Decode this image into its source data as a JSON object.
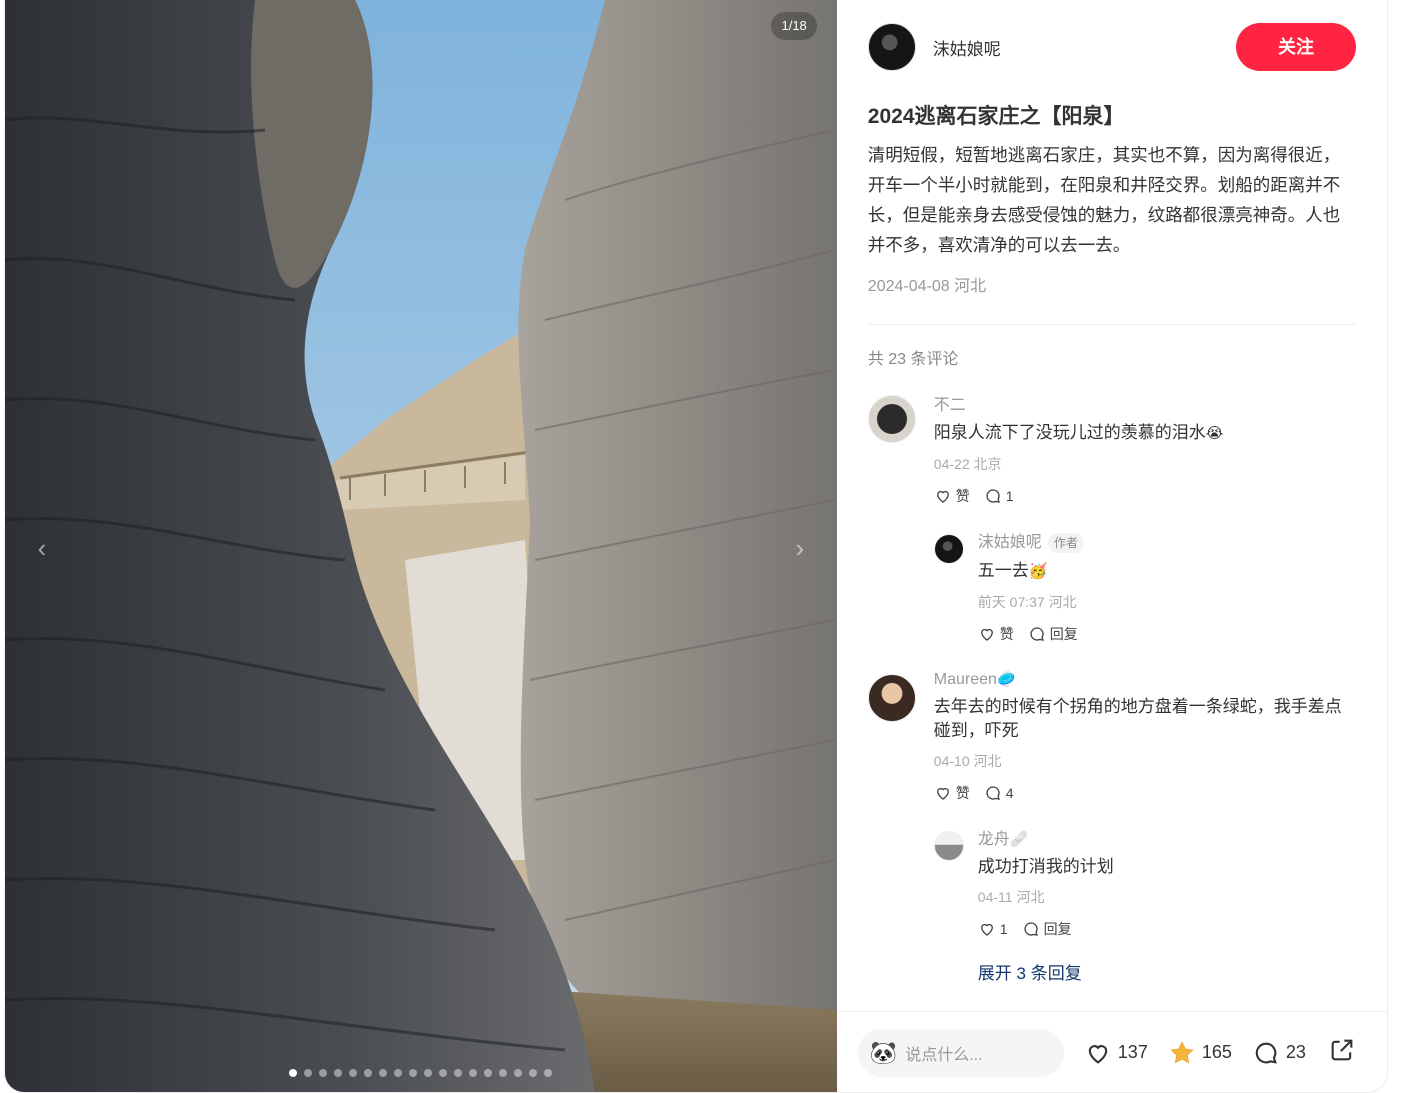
{
  "image": {
    "counter": "1/18",
    "dot_count": 18,
    "active_dot": 0,
    "prev_icon": "chevron-left-icon",
    "next_icon": "chevron-right-icon"
  },
  "author": {
    "name": "沫姑娘呢",
    "follow_label": "关注"
  },
  "post": {
    "title": "2024逃离石家庄之【阳泉】",
    "description": "清明短假，短暂地逃离石家庄，其实也不算，因为离得很近，开车一个半小时就能到，在阳泉和井陉交界。划船的距离并不长，但是能亲身去感受侵蚀的魅力，纹路都很漂亮神奇。人也并不多，喜欢清净的可以去一去。",
    "date_location": "2024-04-08 河北"
  },
  "comments": {
    "total_label": "共 23 条评论",
    "items": [
      {
        "name": "不二",
        "text": "阳泉人流下了没玩儿过的羡慕的泪水",
        "emoji": "😭",
        "meta": "04-22 北京",
        "like_label": "赞",
        "reply_count": "1",
        "replies": [
          {
            "name": "沫姑娘呢",
            "tag": "作者",
            "text": "五一去",
            "emoji": "🥳",
            "meta": "前天 07:37 河北",
            "like_label": "赞",
            "reply_label": "回复"
          }
        ]
      },
      {
        "name": "Maureen",
        "name_emoji": "🥏",
        "text": "去年去的时候有个拐角的地方盘着一条绿蛇，我手差点碰到，吓死",
        "meta": "04-10 河北",
        "like_label": "赞",
        "reply_count": "4",
        "replies": [
          {
            "name": "龙舟",
            "name_emoji": "🩹",
            "text": "成功打消我的计划",
            "meta": "04-11 河北",
            "like_count": "1",
            "reply_label": "回复"
          }
        ],
        "expand_label": "展开 3 条回复"
      }
    ]
  },
  "bottom": {
    "input_placeholder": "说点什么...",
    "likes": "137",
    "collects": "165",
    "comments": "23"
  },
  "colors": {
    "accent": "#ff2442",
    "star": "#f5b53d",
    "link": "#13386c"
  }
}
